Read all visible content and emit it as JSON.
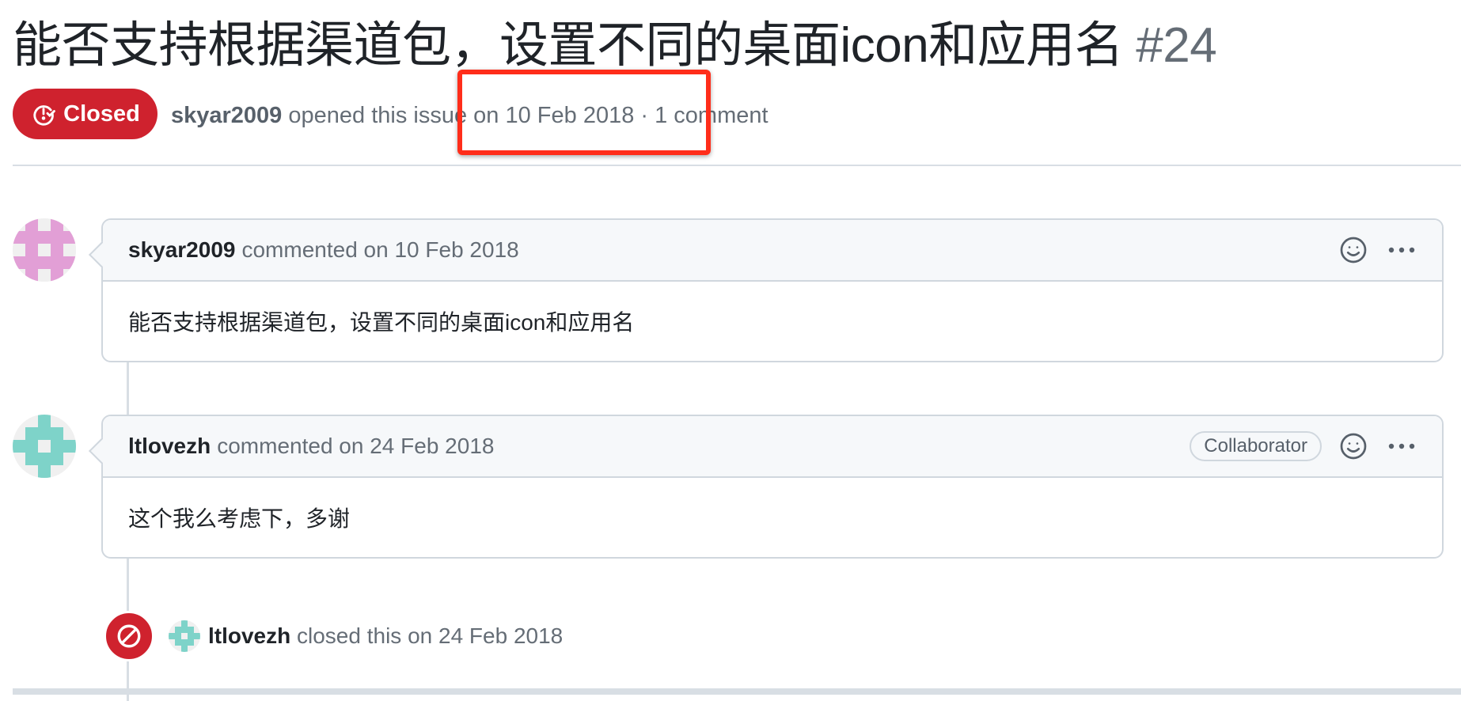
{
  "issue": {
    "title": "能否支持根据渠道包，设置不同的桌面icon和应用名",
    "number": "#24",
    "state": "Closed",
    "state_color": "#cf222e",
    "author": "skyar2009",
    "meta_text": "opened this issue on 10 Feb 2018 · 1 comment"
  },
  "comments": [
    {
      "author": "skyar2009",
      "meta": "commented on 10 Feb 2018",
      "role": "",
      "body": "能否支持根据渠道包，设置不同的桌面icon和应用名",
      "avatar_color": "#e29fd6"
    },
    {
      "author": "ltlovezh",
      "meta": "commented on 24 Feb 2018",
      "role": "Collaborator",
      "body": "这个我么考虑下，多谢",
      "avatar_color": "#7ed3c9"
    }
  ],
  "close_event": {
    "author": "ltlovezh",
    "text": "closed this on 24 Feb 2018"
  },
  "icons": {
    "closed_state": "issue-closed-icon",
    "smiley": "smiley-icon",
    "kebab": "kebab-horizontal-icon",
    "skip": "circle-slash-icon"
  },
  "highlight_color": "#ff2d1a"
}
